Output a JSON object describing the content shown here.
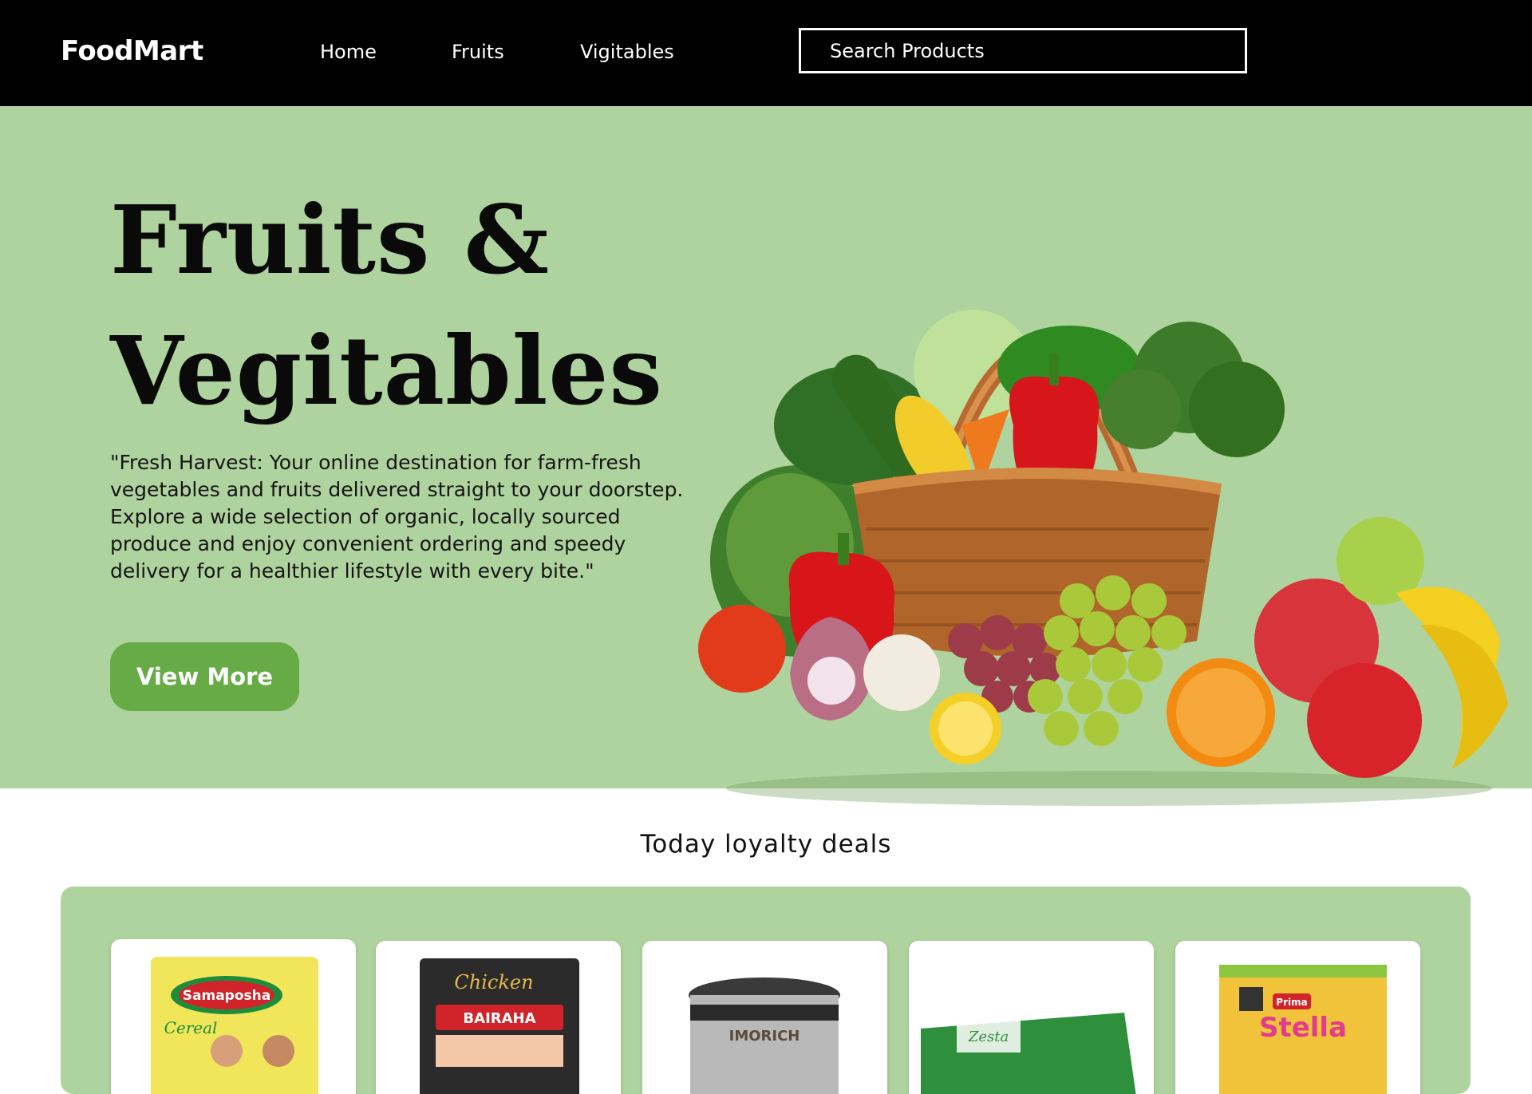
{
  "brand": "FoodMart",
  "nav": {
    "links": [
      "Home",
      "Fruits",
      "Vigitables"
    ],
    "search_placeholder": "Search Products"
  },
  "hero": {
    "title_line1": "Fruits &",
    "title_line2": "Vegitables",
    "description": "\"Fresh Harvest: Your online destination for farm-fresh vegetables and fruits delivered straight to your doorstep. Explore a wide selection of organic, locally sourced produce and enjoy convenient ordering and speedy delivery for a healthier lifestyle with every bite.\"",
    "cta_label": "View More"
  },
  "deals": {
    "title": "Today loyalty deals",
    "products": [
      {
        "brand_text": "Samaposha",
        "sub_text": "Cereal"
      },
      {
        "brand_text": "Chicken",
        "sub_text": "BAIRAHA"
      },
      {
        "brand_text": "IMORICH",
        "sub_text": ""
      },
      {
        "brand_text": "Zesta",
        "sub_text": ""
      },
      {
        "brand_text": "Prima",
        "sub_text": "Stella"
      }
    ]
  },
  "colors": {
    "nav_bg": "#000000",
    "hero_bg": "#afd39e",
    "cta_bg": "#67ab47"
  }
}
